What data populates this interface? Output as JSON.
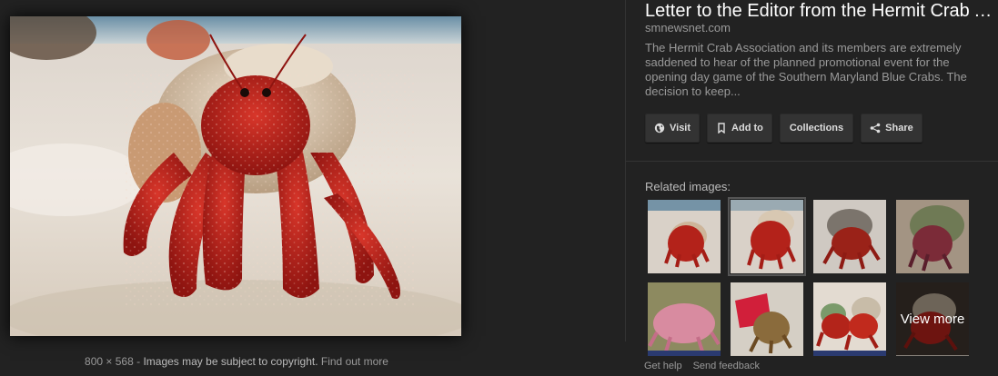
{
  "panel": {
    "title": "Letter to the Editor from the Hermit Crab Association",
    "source": "smnewsnet.com",
    "description": "The Hermit Crab Association and its members are extremely saddened to hear of the planned promotional event for the opening day game of the Southern Maryland Blue Crabs. The decision to keep...",
    "actions": [
      {
        "label": "Visit",
        "icon": "globe-icon"
      },
      {
        "label": "Add to",
        "icon": "bookmark-icon"
      },
      {
        "label": "Collections",
        "icon": ""
      },
      {
        "label": "Share",
        "icon": "share-icon"
      }
    ]
  },
  "image_footer": {
    "dimensions": "800 × 568",
    "separator": "-",
    "notice": "Images may be subject to copyright.",
    "learn_more": "Find out more"
  },
  "related": {
    "label": "Related images:",
    "view_more": "View more",
    "thumbnails": [
      {
        "name": "red hermit crab on sand",
        "selected": false
      },
      {
        "name": "red hermit crab on sand",
        "selected": true
      },
      {
        "name": "hermit crab with dark shell",
        "selected": false
      },
      {
        "name": "purple hermit crab",
        "selected": false
      },
      {
        "name": "pink hermit crab",
        "selected": false
      },
      {
        "name": "hermit crab in red cup",
        "selected": false
      },
      {
        "name": "two hermit crabs",
        "selected": false
      },
      {
        "name": "view more",
        "selected": false
      }
    ]
  },
  "footer_links": {
    "help": "Get help",
    "feedback": "Send feedback"
  },
  "colors": {
    "background": "#222222",
    "button": "#333333",
    "crab_red": "#c0241c",
    "sand": "#e6ddd2"
  }
}
